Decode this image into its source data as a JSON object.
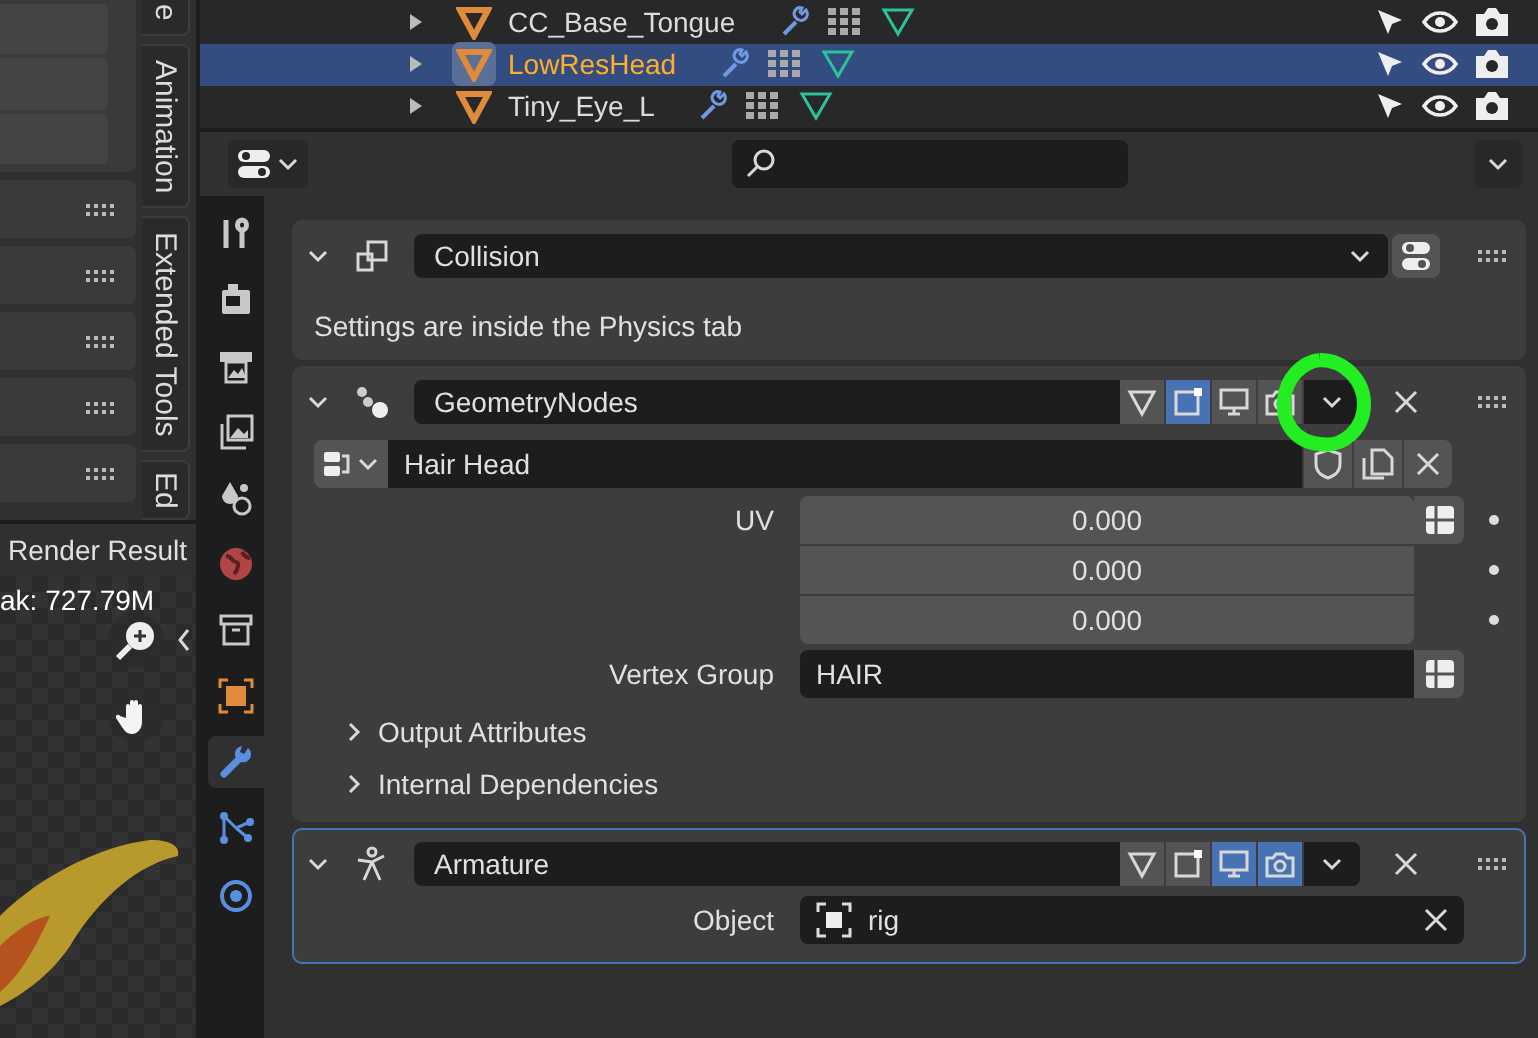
{
  "outliner": {
    "rows": [
      {
        "name": "CC_Base_Tongue",
        "selected": false
      },
      {
        "name": "LowResHead",
        "selected": true
      },
      {
        "name": "Tiny_Eye_L",
        "selected": false
      }
    ]
  },
  "side_tabs": [
    {
      "label": "e"
    },
    {
      "label": "Animation"
    },
    {
      "label": "Extended Tools"
    },
    {
      "label": "Ed"
    }
  ],
  "image_editor": {
    "title": "Render Result",
    "overlay_text": "ak: 727.79M"
  },
  "properties": {
    "tabs": [
      {
        "kind": "tool",
        "selected": false
      },
      {
        "kind": "render",
        "selected": false
      },
      {
        "kind": "output",
        "selected": false
      },
      {
        "kind": "viewlayer",
        "selected": false
      },
      {
        "kind": "scene",
        "selected": false
      },
      {
        "kind": "world",
        "selected": false
      },
      {
        "kind": "collection",
        "selected": false
      },
      {
        "kind": "object",
        "selected": false
      },
      {
        "kind": "modifier",
        "selected": true
      },
      {
        "kind": "particles",
        "selected": false
      },
      {
        "kind": "physics",
        "selected": false
      }
    ],
    "modifiers": [
      {
        "kind": "collision",
        "name": "Collision",
        "expanded": true,
        "active": false,
        "note": "Settings are inside the Physics tab"
      },
      {
        "kind": "nodes",
        "name": "GeometryNodes",
        "expanded": true,
        "active": false,
        "toggles": [
          {
            "kind": "cage",
            "on": false
          },
          {
            "kind": "editmode",
            "on": true
          },
          {
            "kind": "viewport",
            "on": false
          },
          {
            "kind": "render",
            "on": false
          }
        ],
        "node_group": "Hair Head",
        "inputs": [
          {
            "label": "UV",
            "kind": "vector",
            "values": [
              "0.000",
              "0.000",
              "0.000"
            ]
          },
          {
            "label": "Vertex Group",
            "kind": "text",
            "value": "HAIR"
          }
        ],
        "subpanels": [
          {
            "label": "Output Attributes",
            "expanded": false
          },
          {
            "label": "Internal Dependencies",
            "expanded": false
          }
        ]
      },
      {
        "kind": "armature",
        "name": "Armature",
        "expanded": true,
        "active": true,
        "toggles": [
          {
            "kind": "cage",
            "on": false
          },
          {
            "kind": "editmode",
            "on": false
          },
          {
            "kind": "viewport",
            "on": true
          },
          {
            "kind": "render",
            "on": true
          }
        ],
        "inputs": [
          {
            "label": "Object",
            "kind": "object",
            "value": "rig"
          }
        ]
      }
    ]
  }
}
